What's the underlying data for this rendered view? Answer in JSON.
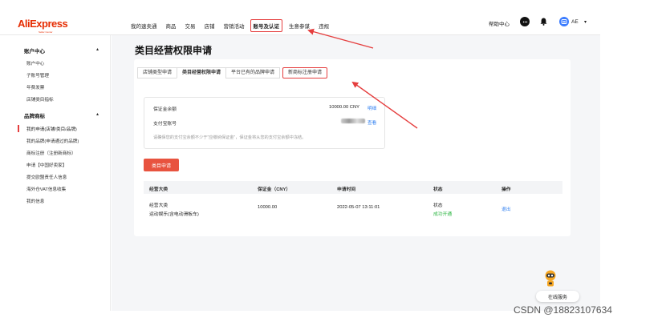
{
  "header": {
    "logo": "AliExpress",
    "logo_sub": "Seller Center",
    "nav": [
      "我的速卖通",
      "商品",
      "交易",
      "店铺",
      "营销活动",
      "账号及认证",
      "生意参谋",
      "违规"
    ],
    "help": "帮助中心",
    "user_initial": "AE",
    "caret": "▾"
  },
  "sidebar": {
    "groups": [
      {
        "label": "账户中心",
        "chevron": "▴",
        "items": [
          "账户中心",
          "子账号管理",
          "年费发票",
          "店铺类目指标"
        ]
      },
      {
        "label": "品牌商标",
        "chevron": "▴",
        "items": [
          "我的申请(店铺/类目/品牌)",
          "我的品牌(申请通过的品牌)",
          "商标注册（注册新商标）",
          "申请【中国好卖家】",
          "提交欧盟责任人信息",
          "海外仓VAT信息收集",
          "我的信息"
        ]
      }
    ]
  },
  "page": {
    "title": "类目经营权限申请",
    "tabs": [
      "店铺类型申请",
      "类目经营权限申请",
      "平台已有的品牌申请",
      "新商标注册申请"
    ]
  },
  "info": {
    "deposit_label": "保证金余额",
    "deposit_value": "10000.00 CNY",
    "deposit_link": "明细",
    "alipay_label": "支付宝账号",
    "alipay_link": "查看",
    "note": "请确保您的支付宝余额不少于\"应缴纳保证金\"，保证金将从您的支付宝余额中冻结。"
  },
  "apply_button": "类目申请",
  "table": {
    "headers": [
      "经营大类",
      "保证金（CNY）",
      "申请时间",
      "状态",
      "操作"
    ],
    "row": {
      "category": "经营大类",
      "subcategory": "运动娱乐(含电动滑板车)",
      "deposit": "10000.00",
      "time": "2022-05-07 13:11:01",
      "status_label": "状态",
      "status_value": "成功开通",
      "action": "退出"
    }
  },
  "service": "在线服务",
  "watermark": "CSDN @18823107634",
  "colors": {
    "brand": "#e62e04",
    "accent_red": "#e53e3e",
    "link": "#2f7ff0",
    "success": "#2ab540"
  }
}
